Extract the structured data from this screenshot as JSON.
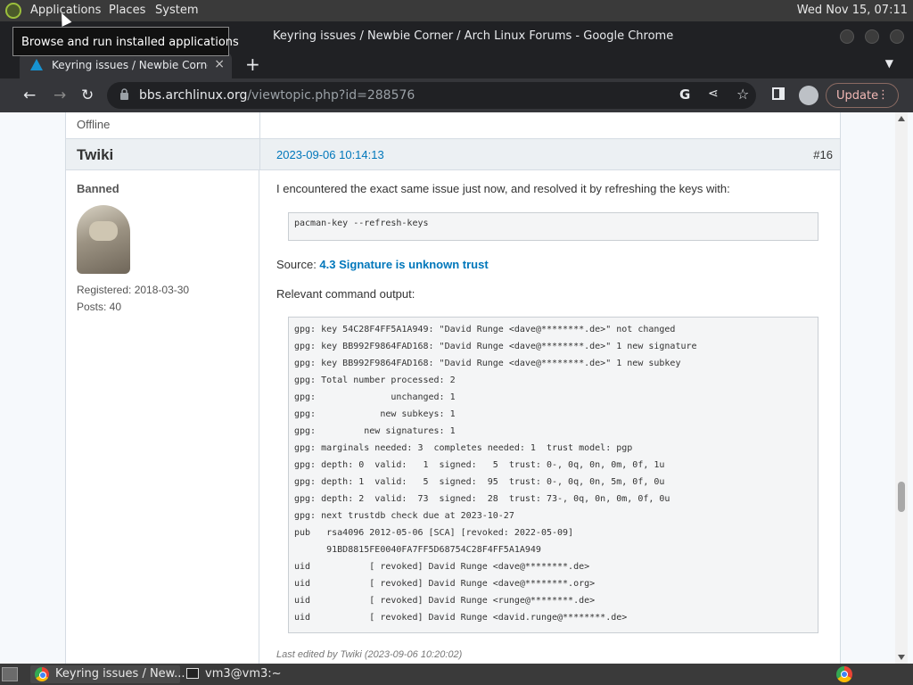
{
  "system_panel": {
    "menus": [
      "Applications",
      "Places",
      "System"
    ],
    "clock": "Wed Nov 15, 07:11"
  },
  "tooltip": "Browse and run installed applications",
  "window": {
    "title": "Keyring issues / Newbie Corner / Arch Linux Forums - Google Chrome"
  },
  "tab": {
    "label": "Keyring issues / Newbie Corner / Arch Linux Forums",
    "close": "×"
  },
  "toolbar": {
    "url_host": "bbs.archlinux.org",
    "url_path": "/viewtopic.php?id=288576",
    "update_label": "Update"
  },
  "post_prev": {
    "status": "Offline"
  },
  "post": {
    "author": "Twiki",
    "date": "2023-09-06 10:14:13",
    "number": "#16",
    "rank": "Banned",
    "registered": "Registered: 2018-03-30",
    "posts": "Posts: 40",
    "intro": "I encountered the exact same issue just now, and resolved it by refreshing the keys with:",
    "command": "pacman-key --refresh-keys",
    "source_label": "Source: ",
    "source_link": "4.3 Signature is unknown trust",
    "output_label": "Relevant command output:",
    "output_lines": [
      "gpg: key 54C28F4FF5A1A949: \"David Runge <dave@********.de>\" not changed",
      "gpg: key BB992F9864FAD168: \"David Runge <dave@********.de>\" 1 new signature",
      "gpg: key BB992F9864FAD168: \"David Runge <dave@********.de>\" 1 new subkey",
      "gpg: Total number processed: 2",
      "gpg:              unchanged: 1",
      "gpg:            new subkeys: 1",
      "gpg:         new signatures: 1",
      "gpg: marginals needed: 3  completes needed: 1  trust model: pgp",
      "gpg: depth: 0  valid:   1  signed:   5  trust: 0-, 0q, 0n, 0m, 0f, 1u",
      "gpg: depth: 1  valid:   5  signed:  95  trust: 0-, 0q, 0n, 5m, 0f, 0u",
      "gpg: depth: 2  valid:  73  signed:  28  trust: 73-, 0q, 0n, 0m, 0f, 0u",
      "gpg: next trustdb check due at 2023-10-27",
      "pub   rsa4096 2012-05-06 [SCA] [revoked: 2022-05-09]",
      "      91BD8815FE0040FA7FF5D68754C28F4FF5A1A949",
      "uid           [ revoked] David Runge <dave@********.de>",
      "uid           [ revoked] David Runge <dave@********.org>",
      "uid           [ revoked] David Runge <runge@********.de>",
      "uid           [ revoked] David Runge <david.runge@********.de>"
    ],
    "edited": "Last edited by Twiki (2023-09-06 10:20:02)"
  },
  "taskbar": {
    "task1": "Keyring issues / New...",
    "task2": "vm3@vm3:~"
  },
  "colors": {
    "link": "#0077bb",
    "chrome_bg": "#202124",
    "update_accent": "#f2b8b5"
  }
}
